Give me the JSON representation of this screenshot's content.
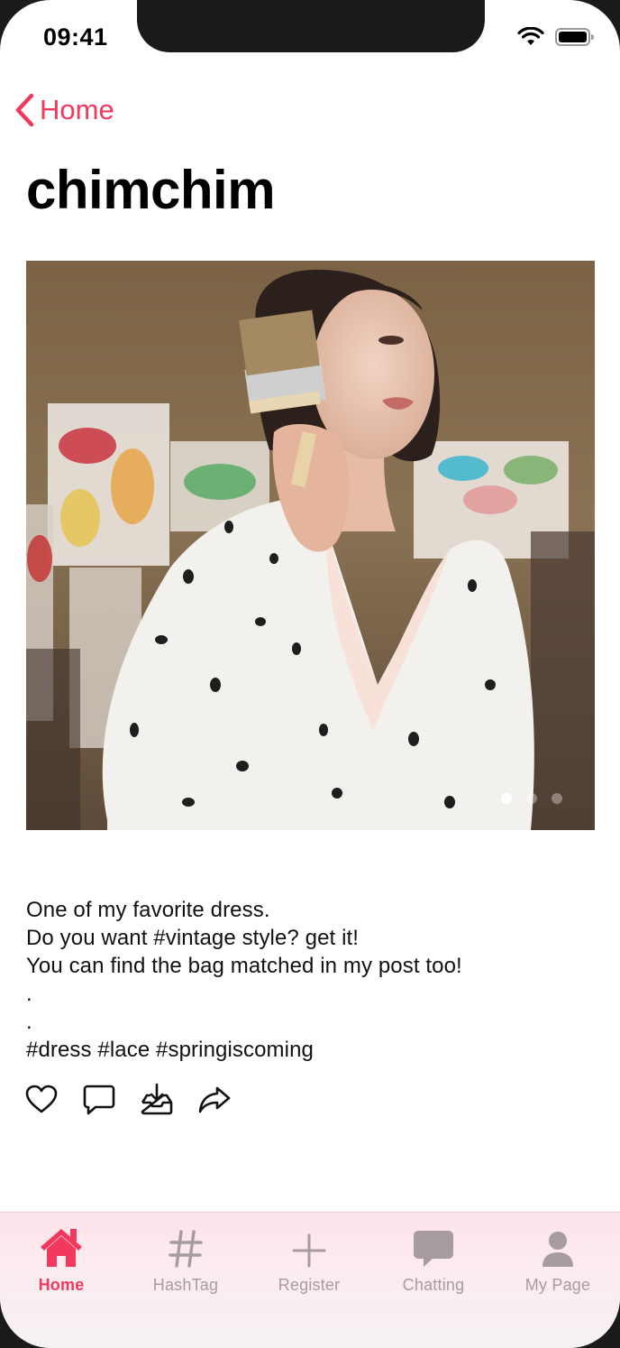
{
  "status_bar": {
    "time": "09:41"
  },
  "nav": {
    "back_label": "Home"
  },
  "page_title": "chimchim",
  "carousel": {
    "page_count": 3,
    "current_page": 1
  },
  "caption": {
    "lines": [
      "One of my favorite dress.",
      "Do you want #vintage style? get it!",
      "You can find the bag matched in my post too!",
      ".",
      ".",
      "#dress #lace #springiscoming"
    ]
  },
  "actions": [
    "heart-icon",
    "comment-icon",
    "save-tray-icon",
    "share-icon"
  ],
  "tabbar": {
    "items": [
      {
        "label": "Home",
        "icon": "house-icon",
        "active": true
      },
      {
        "label": "HashTag",
        "icon": "hashtag-icon",
        "active": false
      },
      {
        "label": "Register",
        "icon": "plus-icon",
        "active": false
      },
      {
        "label": "Chatting",
        "icon": "chat-bubble-icon",
        "active": false
      },
      {
        "label": "My Page",
        "icon": "person-icon",
        "active": false
      }
    ]
  },
  "colors": {
    "accent": "#f2395d",
    "tab_inactive": "#a69ca0",
    "tab_bg": "#fde3ea"
  }
}
